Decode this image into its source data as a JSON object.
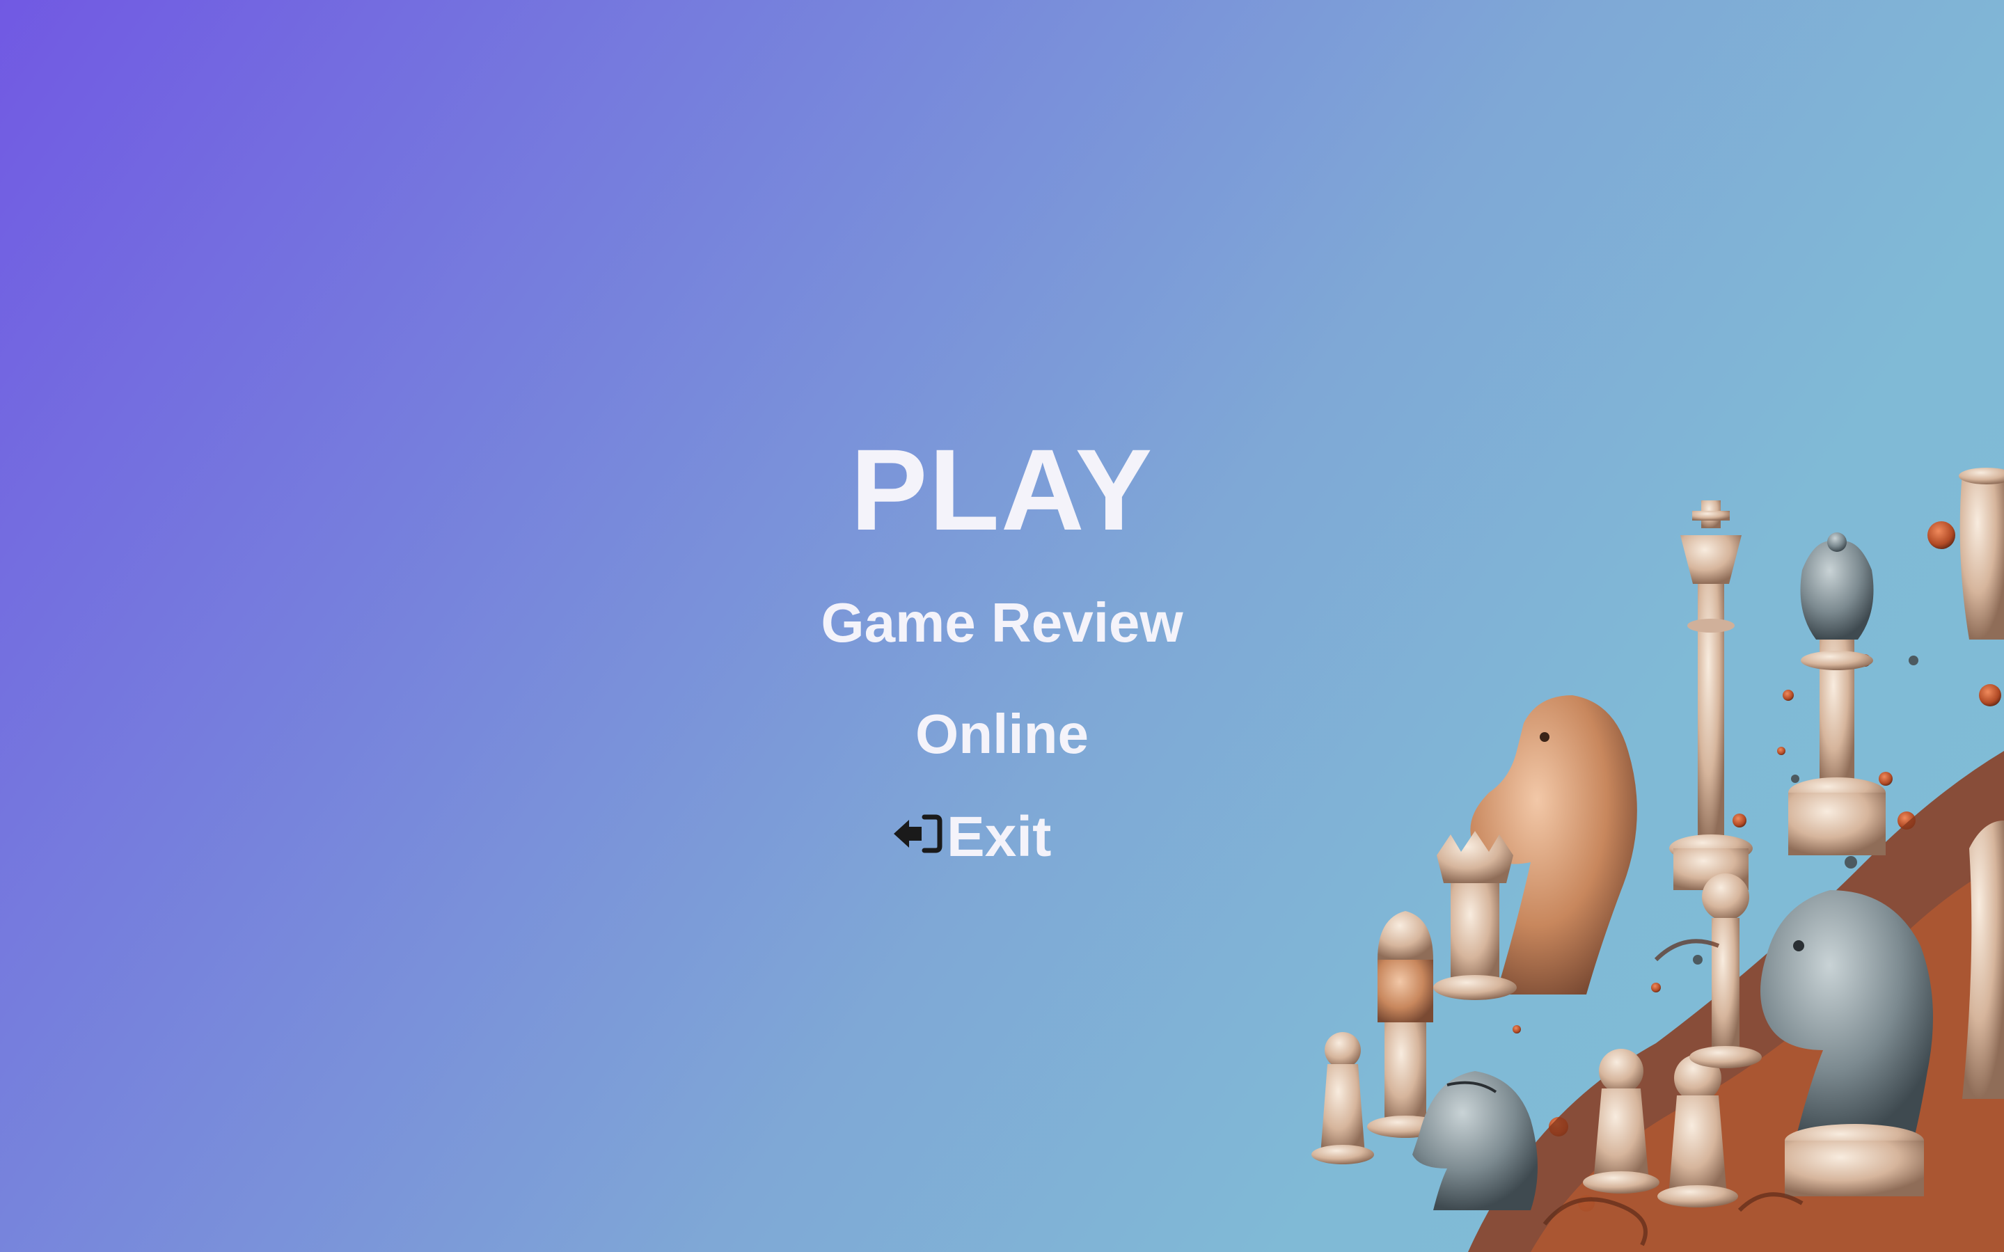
{
  "menu": {
    "play_label": "PLAY",
    "review_label": "Game Review",
    "online_label": "Online",
    "exit_label": "Exit"
  },
  "icons": {
    "exit": "sign-out-icon"
  },
  "colors": {
    "gradient_start": "#7159e3",
    "gradient_end": "#80bdd5",
    "menu_text": "#f4f3fa",
    "icon": "#1a1a1a"
  }
}
